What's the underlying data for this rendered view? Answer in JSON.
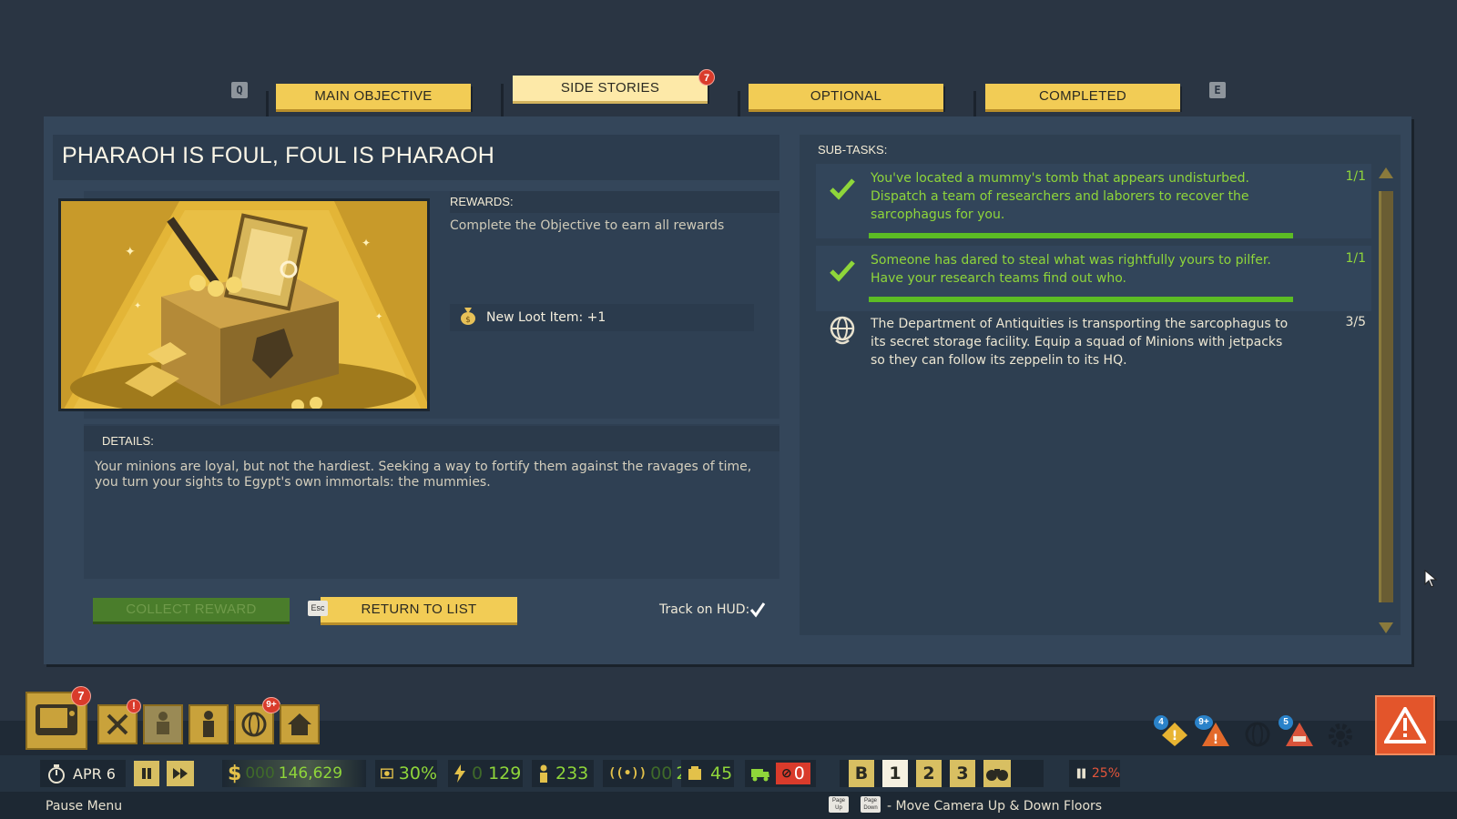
{
  "tabs": {
    "prev_key": "Q",
    "next_key": "E",
    "items": [
      {
        "label": "MAIN OBJECTIVE"
      },
      {
        "label": "SIDE STORIES",
        "badge": "7"
      },
      {
        "label": "OPTIONAL"
      },
      {
        "label": "COMPLETED"
      }
    ]
  },
  "quest": {
    "title": "PHARAOH IS FOUL, FOUL IS PHARAOH",
    "rewards_header": "REWARDS:",
    "rewards_desc": "Complete the Objective to earn all rewards",
    "loot_item": "New Loot Item: +1",
    "details_header": "DETAILS:",
    "details_text": "Your minions are loyal, but not the hardiest. Seeking a way to fortify them against the ravages of time, you turn your sights to Egypt's own immortals: the mummies.",
    "collect_label": "COLLECT REWARD",
    "return_label": "RETURN TO LIST",
    "esc_key": "Esc",
    "track_label": "Track on HUD:",
    "track_checked": true
  },
  "subtasks": {
    "header": "SUB-TASKS:",
    "items": [
      {
        "text": "You've located a mummy's tomb that appears undisturbed. Dispatch a team of researchers and laborers to recover the sarcophagus for you.",
        "count": "1/1",
        "done": true,
        "icon": "checkmark-icon"
      },
      {
        "text": "Someone has dared to steal what was rightfully yours to pilfer. Have your research teams find out who.",
        "count": "1/1",
        "done": true,
        "icon": "checkmark-icon"
      },
      {
        "text": "The Department of Antiquities is transporting the sarcophagus to its secret storage facility. Equip a squad of Minions with jetpacks so they can follow its zeppelin to its HQ.",
        "count": "3/5",
        "done": false,
        "icon": "globe-hand-icon"
      }
    ]
  },
  "hud": {
    "menu_badges": {
      "objectives": "7",
      "build": "!",
      "world": "9+"
    },
    "alerts": {
      "alert1": "4",
      "alert2": "9+",
      "alert3": "5"
    },
    "date": "APR 6",
    "money_dim": "000",
    "money": "146,629",
    "heat": "30%",
    "power_dim": "0",
    "power": "129",
    "minions": "233",
    "signal_dim": "00",
    "signal": "2",
    "loot": "45",
    "vehicles": "0",
    "floor_b": "B",
    "floors": [
      "1",
      "2",
      "3"
    ],
    "speed": "25%",
    "pause_menu": "Pause Menu",
    "help": "- Move Camera Up & Down Floors",
    "key_page_up": "Page Up",
    "key_page_down": "Page Down"
  },
  "colors": {
    "accent": "#f2cc55",
    "success": "#8fd63a",
    "panel": "#34465a",
    "alert": "#e3552b"
  }
}
